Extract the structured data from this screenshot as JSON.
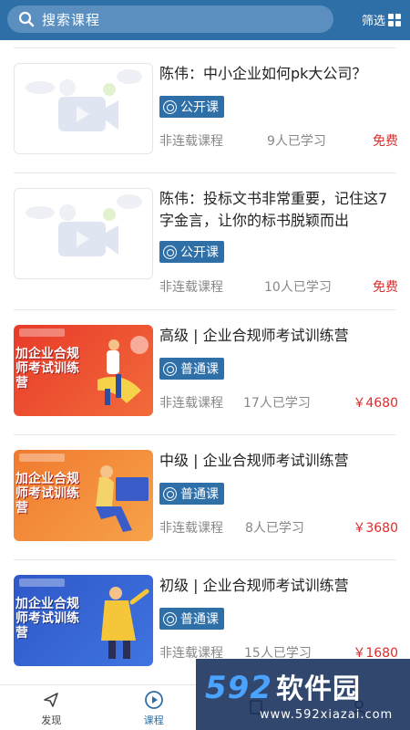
{
  "header": {
    "search_placeholder": "搜索课程",
    "search_icon": "search-icon",
    "filter_label": "筛选",
    "filter_icon": "grid-icon",
    "bg_color": "#2f6fa8"
  },
  "courses": [
    {
      "title": "陈伟：中小企业如何pk大公司？",
      "badge": "公开课",
      "type": "非连载课程",
      "learners": "9人已学习",
      "price": "免费",
      "thumb": "placeholder"
    },
    {
      "title": "陈伟：投标文书非常重要，记住这7字金言，让你的标书脱颖而出",
      "badge": "公开课",
      "type": "非连载课程",
      "learners": "10人已学习",
      "price": "免费",
      "thumb": "placeholder"
    },
    {
      "title": "高级 | 企业合规师考试训练营",
      "badge": "普通课",
      "type": "非连载课程",
      "learners": "17人已学习",
      "price": "￥4680",
      "thumb": "promo-red",
      "thumb_text": "加企业合规师考试训练营"
    },
    {
      "title": "中级 | 企业合规师考试训练营",
      "badge": "普通课",
      "type": "非连载课程",
      "learners": "8人已学习",
      "price": "￥3680",
      "thumb": "promo-orange",
      "thumb_text": "加企业合规师考试训练营"
    },
    {
      "title": "初级 | 企业合规师考试训练营",
      "badge": "普通课",
      "type": "非连载课程",
      "learners": "15人已学习",
      "price": "￥1680",
      "thumb": "promo-blue",
      "thumb_text": "加企业合规师考试训练营"
    }
  ],
  "tabbar": {
    "items": [
      {
        "label": "发现",
        "icon": "paper-plane-icon",
        "active": false
      },
      {
        "label": "课程",
        "icon": "play-circle-icon",
        "active": true
      },
      {
        "label": "",
        "icon": "book-icon",
        "active": false
      },
      {
        "label": "",
        "icon": "user-icon",
        "active": false
      }
    ]
  },
  "watermark": {
    "brand_num": "592",
    "brand_cn": "软件园",
    "url": "www.592xiazai.com"
  }
}
